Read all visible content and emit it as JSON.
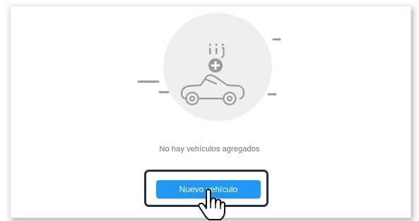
{
  "empty_state": {
    "message": "No hay vehículos agregados",
    "illustration_icons": [
      "car-icon",
      "add-icon"
    ]
  },
  "actions": {
    "new_vehicle_label": "Nuevo vehículo"
  },
  "colors": {
    "accent": "#2196f3",
    "highlight_border": "#1f3146",
    "illustration_stroke": "#9a9a9a",
    "illustration_circle": "#efefef",
    "message_text": "#6f6f6f"
  },
  "cursor": {
    "icon": "hand-pointer-icon"
  }
}
